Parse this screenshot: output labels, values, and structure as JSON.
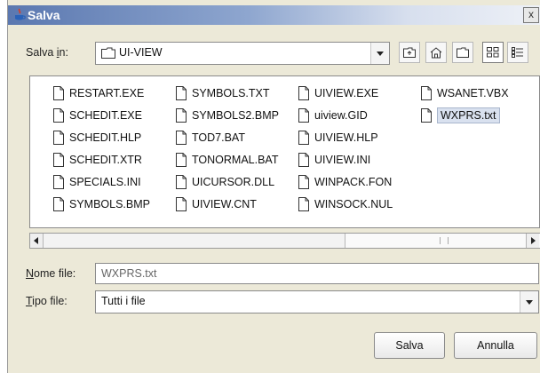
{
  "window": {
    "title": "Salva",
    "close_glyph": "x"
  },
  "save_in": {
    "label_prefix": "Salva ",
    "label_underlined": "i",
    "label_suffix": "n:",
    "selected": "UI-VIEW",
    "folder_icon": "folder-icon"
  },
  "toolbar": [
    {
      "name": "up-one-level-button",
      "icon": "up-folder-icon"
    },
    {
      "name": "home-button",
      "icon": "home-icon"
    },
    {
      "name": "new-folder-button",
      "icon": "new-folder-icon"
    },
    {
      "name": "list-view-button",
      "icon": "list-view-icon",
      "selected": true
    },
    {
      "name": "details-view-button",
      "icon": "details-view-icon"
    }
  ],
  "files": {
    "columns": [
      [
        "RESTART.EXE",
        "SCHEDIT.EXE",
        "SCHEDIT.HLP",
        "SCHEDIT.XTR",
        "SPECIALS.INI",
        "SYMBOLS.BMP"
      ],
      [
        "SYMBOLS.TXT",
        "SYMBOLS2.BMP",
        "TOD7.BAT",
        "TONORMAL.BAT",
        "UICURSOR.DLL",
        "UIVIEW.CNT"
      ],
      [
        "UIVIEW.EXE",
        "uiview.GID",
        "UIVIEW.HLP",
        "UIVIEW.INI",
        "WINPACK.FON",
        "WINSOCK.NUL"
      ],
      [
        "WSANET.VBX",
        "WXPRS.txt"
      ]
    ],
    "selected": "WXPRS.txt"
  },
  "file_name": {
    "label_underlined": "N",
    "label_rest": "ome file:",
    "value": "WXPRS.txt"
  },
  "file_type": {
    "label_underlined": "T",
    "label_rest": "ipo file:",
    "value": "Tutti i file"
  },
  "buttons": {
    "save": "Salva",
    "cancel": "Annulla"
  },
  "colors": {
    "titlebar_start": "#5b78b0",
    "dialog_bg": "#ece9d8",
    "selection": "#d9e1ef"
  }
}
